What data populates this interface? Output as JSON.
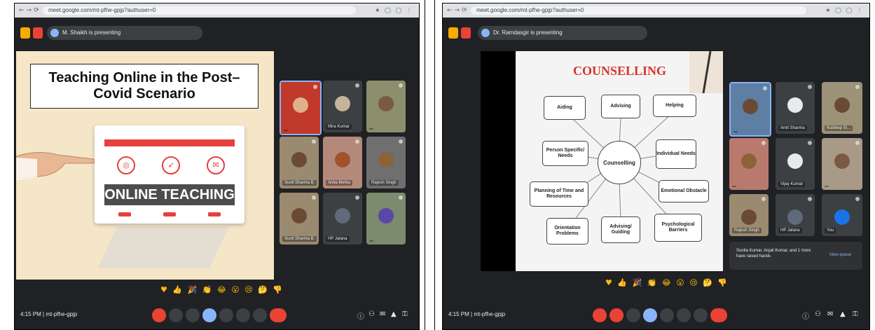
{
  "left_panel": {
    "presenting_label": "M. Shaikh is presenting",
    "slide": {
      "title": "Teaching Online in the Post–Covid Scenario",
      "banner": "ONLINE TEACHING"
    },
    "participants": [
      {
        "name": ""
      },
      {
        "name": "Mira Kumar"
      },
      {
        "name": ""
      },
      {
        "name": "Sunil Sharma B."
      },
      {
        "name": "Anita Mehta"
      },
      {
        "name": "Rajesh Singh"
      },
      {
        "name": "Sunil Sharma B."
      },
      {
        "name": "HP Jalana"
      },
      {
        "name": ""
      }
    ],
    "clock": "4:15 PM  |  mt-pfhe-gpjp"
  },
  "right_panel": {
    "presenting_label": "Dr. Ramdasgir is presenting",
    "slide": {
      "title": "COUNSELLING",
      "center": "Counselling",
      "nodes": {
        "aiding": "Aiding",
        "advising": "Advising",
        "helping": "Helping",
        "person_specific": "Person Specific/ Needs",
        "individual_needs": "Individual Needs",
        "planning": "Planning of Time and Resources",
        "emotional": "Emotional Obstacle",
        "orientation": "Orientation Problems",
        "advising_guiding": "Advising/ Guiding",
        "psychological": "Psychological Barriers"
      }
    },
    "participants": [
      {
        "name": ""
      },
      {
        "name": "Amit Sharma"
      },
      {
        "name": "Kuldeep Si..."
      },
      {
        "name": ""
      },
      {
        "name": "Vijay Kumar"
      },
      {
        "name": ""
      },
      {
        "name": "Rajesh Singh"
      },
      {
        "name": "HP Jalana"
      },
      {
        "name": "You"
      }
    ],
    "notice": {
      "text": "Sunita Kumar, Anjali Kumar, and 1 more have raised hands",
      "action": "View queue"
    },
    "clock": "4:15 PM  |  mt-pfhe-gpjp"
  },
  "browser": {
    "left_url": "meet.google.com/mt-pfhe-gpjp?authuser=0",
    "right_url": "meet.google.com/mt-pfhe-gpjp?authuser=0"
  },
  "reactions": "♥ 👍 🎉 👏 😂 😮 😢 🤔 👎",
  "colors": {
    "meet_bg": "#202124",
    "accent_red": "#ea4335",
    "accent_blue": "#8ab4f8",
    "accent_yellow": "#f9ab00"
  }
}
